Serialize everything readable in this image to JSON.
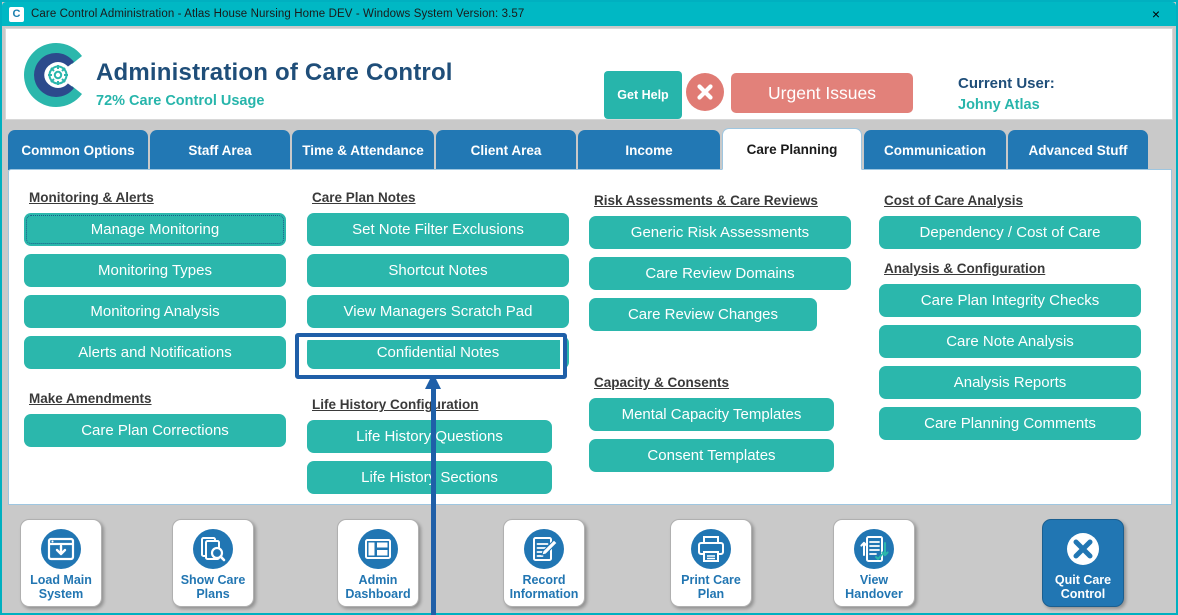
{
  "window": {
    "title": "Care Control Administration - Atlas House Nursing Home DEV - Windows System Version: 3.57",
    "icon": "C",
    "close_icon": "×"
  },
  "header": {
    "logo_icon": "care-control-logo",
    "title": "Administration of Care Control",
    "subtitle": "72% Care Control Usage",
    "get_help_label": "Get Help",
    "close_circle_icon": "x-circle-icon",
    "urgent_label": "Urgent Issues",
    "current_user_label": "Current User:",
    "current_user_name": "Johny Atlas",
    "colors": {
      "teal": "#2bb7ac",
      "dark_blue": "#1f4e79",
      "red": "#e2817a",
      "tab_blue": "#2278b4"
    }
  },
  "tabs": [
    {
      "label": "Common Options",
      "active": false
    },
    {
      "label": "Staff Area",
      "active": false
    },
    {
      "label": "Time & Attendance",
      "active": false
    },
    {
      "label": "Client Area",
      "active": false
    },
    {
      "label": "Income",
      "active": false
    },
    {
      "label": "Care Planning",
      "active": true
    },
    {
      "label": "Communication",
      "active": false
    },
    {
      "label": "Advanced Stuff",
      "active": false
    }
  ],
  "panel": {
    "columns": [
      {
        "groups": [
          {
            "heading": "Monitoring & Alerts",
            "buttons": [
              "Manage Monitoring",
              "Monitoring Types",
              "Monitoring Analysis",
              "Alerts and Notifications"
            ]
          },
          {
            "heading": "Make Amendments",
            "buttons": [
              "Care Plan Corrections"
            ]
          }
        ]
      },
      {
        "groups": [
          {
            "heading": "Care Plan Notes",
            "buttons": [
              "Set Note Filter Exclusions",
              "Shortcut Notes",
              "View Managers Scratch Pad",
              "Confidential Notes"
            ]
          },
          {
            "heading": "Life History Configuration",
            "buttons": [
              "Life History Questions",
              "Life History Sections"
            ]
          }
        ]
      },
      {
        "groups": [
          {
            "heading": "Risk Assessments & Care Reviews",
            "buttons": [
              "Generic Risk Assessments",
              "Care Review Domains",
              "Care Review Changes"
            ]
          },
          {
            "heading": "Capacity & Consents",
            "buttons": [
              "Mental Capacity Templates",
              "Consent Templates"
            ]
          }
        ]
      },
      {
        "groups": [
          {
            "heading": "Cost of Care Analysis",
            "buttons": [
              "Dependency / Cost of Care"
            ]
          },
          {
            "heading": "Analysis & Configuration",
            "buttons": [
              "Care Plan Integrity Checks",
              "Care Note Analysis",
              "Analysis Reports",
              "Care Planning Comments"
            ]
          }
        ]
      }
    ]
  },
  "highlight": {
    "target_label": "Confidential Notes",
    "color": "#1f5fa8"
  },
  "toolbar": {
    "buttons": [
      {
        "label_line1": "Load Main",
        "label_line2": "System",
        "icon": "load-main-system-icon"
      },
      {
        "label_line1": "Show Care",
        "label_line2": "Plans",
        "icon": "show-care-plans-icon"
      },
      {
        "label_line1": "Admin",
        "label_line2": "Dashboard",
        "icon": "admin-dashboard-icon"
      },
      {
        "label_line1": "Record",
        "label_line2": "Information",
        "icon": "record-information-icon"
      },
      {
        "label_line1": "Print Care",
        "label_line2": "Plan",
        "icon": "print-care-plan-icon"
      },
      {
        "label_line1": "View",
        "label_line2": "Handover",
        "icon": "view-handover-icon"
      },
      {
        "label_line1": "Quit Care",
        "label_line2": "Control",
        "icon": "quit-care-control-icon"
      }
    ]
  }
}
